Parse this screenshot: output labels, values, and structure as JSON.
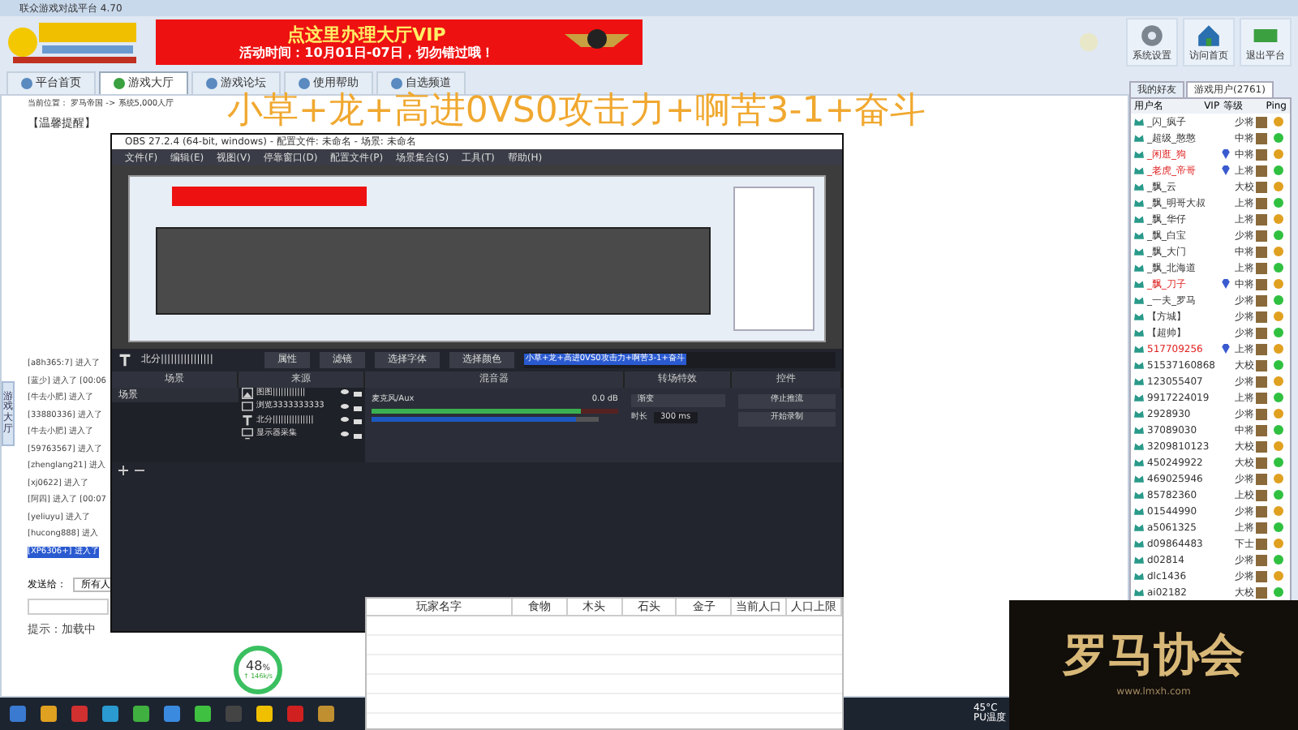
{
  "window": {
    "title": "联众游戏对战平台 4.70"
  },
  "banner": {
    "headline": "点这里办理大厅VIP",
    "subline": "活动时间：10月01日-07日，切勿错过哦！"
  },
  "top_buttons": [
    {
      "label": "系统设置",
      "kind": "gear"
    },
    {
      "label": "访问首页",
      "kind": "home"
    },
    {
      "label": "退出平台",
      "kind": "exit"
    }
  ],
  "tabs": [
    {
      "label": "平台首页",
      "selected": false
    },
    {
      "label": "游戏大厅",
      "selected": true
    },
    {
      "label": "游戏论坛",
      "selected": false
    },
    {
      "label": "使用帮助",
      "selected": false
    },
    {
      "label": "自选频道",
      "selected": false
    }
  ],
  "breadcrumb": "当前位置： 罗马帝国 -> 系统5,000人厅",
  "notice": "【温馨提醒】",
  "side_tab": "游戏大厅",
  "chat_lines": [
    {
      "text": "[a8h365:7] 进入了"
    },
    {
      "text": "[蓝少] 进入了 [00:06"
    },
    {
      "text": "[牛去小肥] 进入了"
    },
    {
      "text": "[33880336] 进入了"
    },
    {
      "text": "[牛去小肥] 进入了"
    },
    {
      "text": "[59763567] 进入了"
    },
    {
      "text": "[zhenglang21] 进入"
    },
    {
      "text": "[xj0622] 进入了"
    },
    {
      "text": "[阿四] 进入了 [00:07"
    },
    {
      "text": "[yeliuyu] 进入了"
    },
    {
      "text": "[hucong888] 进入"
    }
  ],
  "selected_chat_line": "[XP6306+] 进入了",
  "send_to": {
    "label": "发送给：",
    "value": "所有人"
  },
  "hint": "提示：加载中",
  "user_panel": {
    "tabs": [
      {
        "label": "我的好友",
        "selected": false
      },
      {
        "label": "游戏用户(2761)",
        "selected": true
      }
    ],
    "columns": [
      "用户名",
      "VIP",
      "等级",
      "Ping"
    ],
    "rows": [
      {
        "name": "_闪_疯子",
        "vip": false,
        "rank": "少将",
        "color": "#e0a020"
      },
      {
        "name": "_超级_憨憨",
        "vip": false,
        "rank": "中将",
        "color": "#30c040"
      },
      {
        "name": "_闲逛_狗",
        "vip": true,
        "rank": "中将",
        "color": "#e0a020"
      },
      {
        "name": "_老虎_帝哥",
        "vip": true,
        "rank": "上将",
        "color": "#30c040"
      },
      {
        "name": "_飘_云",
        "vip": false,
        "rank": "大校",
        "color": "#e0a020"
      },
      {
        "name": "_飘_明哥大叔",
        "vip": false,
        "rank": "上将",
        "color": "#30c040"
      },
      {
        "name": "_飘_华仔",
        "vip": false,
        "rank": "上将",
        "color": "#e0a020"
      },
      {
        "name": "_飘_白宝",
        "vip": false,
        "rank": "少将",
        "color": "#30c040"
      },
      {
        "name": "_飘_大门",
        "vip": false,
        "rank": "中将",
        "color": "#e0a020"
      },
      {
        "name": "_飘_北海道",
        "vip": false,
        "rank": "上将",
        "color": "#30c040"
      },
      {
        "name": "_飘_刀子",
        "vip": true,
        "rank": "中将",
        "color": "#e0a020"
      },
      {
        "name": "_一夫_罗马",
        "vip": false,
        "rank": "少将",
        "color": "#30c040"
      },
      {
        "name": "【方城】",
        "vip": false,
        "rank": "少将",
        "color": "#e0a020"
      },
      {
        "name": "【超帅】",
        "vip": false,
        "rank": "少将",
        "color": "#30c040"
      },
      {
        "name": "517709256",
        "vip": true,
        "rank": "上将",
        "color": "#e0a020"
      },
      {
        "name": "51537160868",
        "vip": false,
        "rank": "大校",
        "color": "#30c040"
      },
      {
        "name": "123055407",
        "vip": false,
        "rank": "少将",
        "color": "#e0a020"
      },
      {
        "name": "9917224019",
        "vip": false,
        "rank": "上将",
        "color": "#30c040"
      },
      {
        "name": "2928930",
        "vip": false,
        "rank": "少将",
        "color": "#e0a020"
      },
      {
        "name": "37089030",
        "vip": false,
        "rank": "中将",
        "color": "#30c040"
      },
      {
        "name": "3209810123",
        "vip": false,
        "rank": "大校",
        "color": "#e0a020"
      },
      {
        "name": "450249922",
        "vip": false,
        "rank": "大校",
        "color": "#30c040"
      },
      {
        "name": "469025946",
        "vip": false,
        "rank": "少将",
        "color": "#e0a020"
      },
      {
        "name": "85782360",
        "vip": false,
        "rank": "上校",
        "color": "#30c040"
      },
      {
        "name": "01544990",
        "vip": false,
        "rank": "少将",
        "color": "#e0a020"
      },
      {
        "name": "a5061325",
        "vip": false,
        "rank": "上将",
        "color": "#30c040"
      },
      {
        "name": "d09864483",
        "vip": false,
        "rank": "下士",
        "color": "#e0a020"
      },
      {
        "name": "d02814",
        "vip": false,
        "rank": "少将",
        "color": "#30c040"
      },
      {
        "name": "dlc1436",
        "vip": false,
        "rank": "少将",
        "color": "#e0a020"
      },
      {
        "name": "ai02182",
        "vip": false,
        "rank": "大校",
        "color": "#30c040"
      }
    ]
  },
  "obs": {
    "title": "OBS 27.2.4 (64-bit, windows) - 配置文件: 未命名 - 场景: 未命名",
    "menu": [
      "文件(F)",
      "编辑(E)",
      "视图(V)",
      "停靠窗口(D)",
      "配置文件(P)",
      "场景集合(S)",
      "工具(T)",
      "帮助(H)"
    ],
    "overlay_text": "小草+龙+高进0VS0攻击力+啊苦3-1+奋斗",
    "toolbar": {
      "source_name": "北分||||||||||||||||",
      "buttons": [
        "属性",
        "滤镜",
        "选择字体",
        "选择颜色"
      ],
      "text_value": "小草+龙+高进0VS0攻击力+啊苦3-1+奋斗"
    },
    "docks": [
      "场景",
      "来源",
      "混音器",
      "转场特效",
      "控件"
    ],
    "scenes": [
      {
        "label": "场景",
        "selected": true
      }
    ],
    "sources": [
      {
        "label": "图图||||||||||||",
        "kind": "image"
      },
      {
        "label": "浏览3333333333",
        "kind": "browser"
      },
      {
        "label": "北分|||||||||||||||",
        "kind": "text"
      },
      {
        "label": "显示器采集",
        "kind": "monitor"
      }
    ],
    "mixer": {
      "name": "麦克风/Aux",
      "reading": "0.0 dB",
      "level": 0.85,
      "slider": {
        "level": 0.9
      }
    },
    "transition": {
      "value": "渐变",
      "duration_label": "时长",
      "duration": "300 ms"
    },
    "controls": [
      "停止推流",
      "开始录制"
    ],
    "cpu": {
      "percent": "48",
      "unit": "%",
      "rate": "↑ 146k/s"
    }
  },
  "stats_table": {
    "columns": [
      "玩家名字",
      "食物",
      "木头",
      "石头",
      "金子",
      "当前人口",
      "人口上限"
    ]
  },
  "logo_overlay": {
    "text": "罗马协会",
    "url": "www.lmxh.com"
  },
  "tray": {
    "temp": "45°C",
    "label": "PU温度"
  }
}
